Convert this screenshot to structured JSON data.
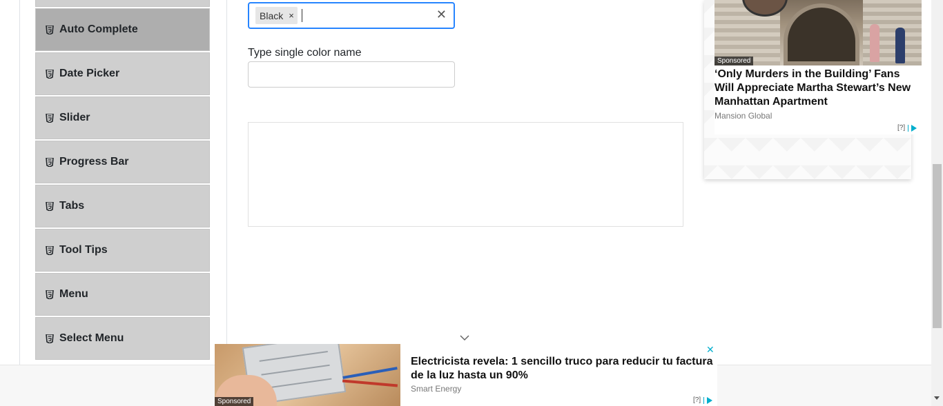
{
  "sidebar": {
    "items": [
      {
        "label": "",
        "active": false
      },
      {
        "label": "Auto Complete",
        "active": true
      },
      {
        "label": "Date Picker",
        "active": false
      },
      {
        "label": "Slider",
        "active": false
      },
      {
        "label": "Progress Bar",
        "active": false
      },
      {
        "label": "Tabs",
        "active": false
      },
      {
        "label": "Tool Tips",
        "active": false
      },
      {
        "label": "Menu",
        "active": false
      },
      {
        "label": "Select Menu",
        "active": false
      }
    ],
    "item_icon": "html5-icon"
  },
  "form": {
    "multi_input": {
      "chips": [
        "Black"
      ],
      "chip_remove_glyph": "×",
      "clear_glyph": "✕"
    },
    "single_input": {
      "label": "Type single color name",
      "value": ""
    }
  },
  "side_ad": {
    "sponsored": "Sponsored",
    "title": "‘Only Murders in the Building’ Fans Will Appreciate Martha Stewart’s New Manhattan Apartment",
    "source": "Mansion Global",
    "adchoices": "[?]"
  },
  "bottom_ad": {
    "sponsored": "Sponsored",
    "title": "Electricista revela: 1 sencillo truco para reducir tu factura de la luz hasta un 90%",
    "source": "Smart Energy",
    "adchoices": "[?]",
    "close_glyph": "✕"
  },
  "colors": {
    "focus_border": "#2684ff",
    "menu_bg": "#cfcfcf",
    "menu_active_bg": "#aeaeae",
    "adchoice_accent": "#00aecd"
  }
}
